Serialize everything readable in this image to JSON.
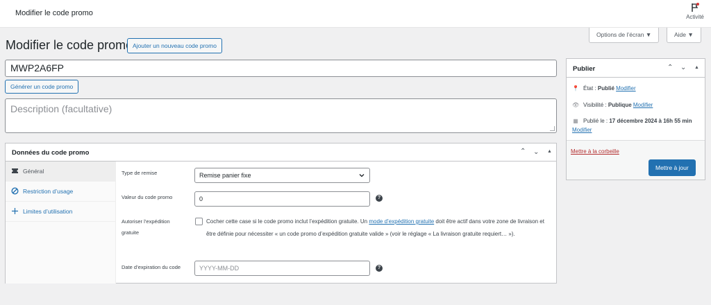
{
  "topbar": {
    "title": "Modifier le code promo",
    "activity_label": "Activité"
  },
  "screen_options": {
    "options_label": "Options de l’écran",
    "help_label": "Aide"
  },
  "page": {
    "heading": "Modifier le code promo",
    "add_new_label": "Ajouter un nouveau code promo",
    "code_value": "MWP2A6FP",
    "generate_label": "Générer un code promo",
    "description_placeholder": "Description (facultative)"
  },
  "coupon_data": {
    "title": "Données du code promo",
    "tabs": [
      {
        "label": "Général",
        "icon": "ticket-icon",
        "active": true
      },
      {
        "label": "Restriction d’usage",
        "icon": "ban-icon",
        "active": false
      },
      {
        "label": "Limites d’utilisation",
        "icon": "plus-icon",
        "active": false
      }
    ],
    "fields": {
      "discount_type_label": "Type de remise",
      "discount_type_value": "Remise panier fixe",
      "amount_label": "Valeur du code promo",
      "amount_value": "0",
      "free_shipping_label_1": "Autoriser l’expédition",
      "free_shipping_label_2": "gratuite",
      "free_shipping_checked": false,
      "free_shipping_text_before": "Cocher cette case si le code promo inclut l’expédition gratuite. Un ",
      "free_shipping_link": "mode d’expédition gratuite",
      "free_shipping_text_after": " doit être actif dans votre zone de livraison et être définie pour nécessiter « un code promo d’expédition gratuite valide » (voir le réglage « La livraison gratuite requiert… »).",
      "expiry_label": "Date d’expiration du code",
      "expiry_placeholder": "YYYY-MM-DD"
    }
  },
  "publish": {
    "title": "Publier",
    "status_label": "État : ",
    "status_value": "Publié",
    "visibility_label": "Visibilité : ",
    "visibility_value": "Publique",
    "published_label": "Publié le : ",
    "published_value": "17 décembre 2024 à 16h 55 min",
    "edit_label": "Modifier",
    "trash_label": "Mettre à la corbeille",
    "update_label": "Mettre à jour"
  },
  "colors": {
    "accent": "#2271b1",
    "danger": "#b32d2e",
    "background": "#f0f0f1"
  }
}
